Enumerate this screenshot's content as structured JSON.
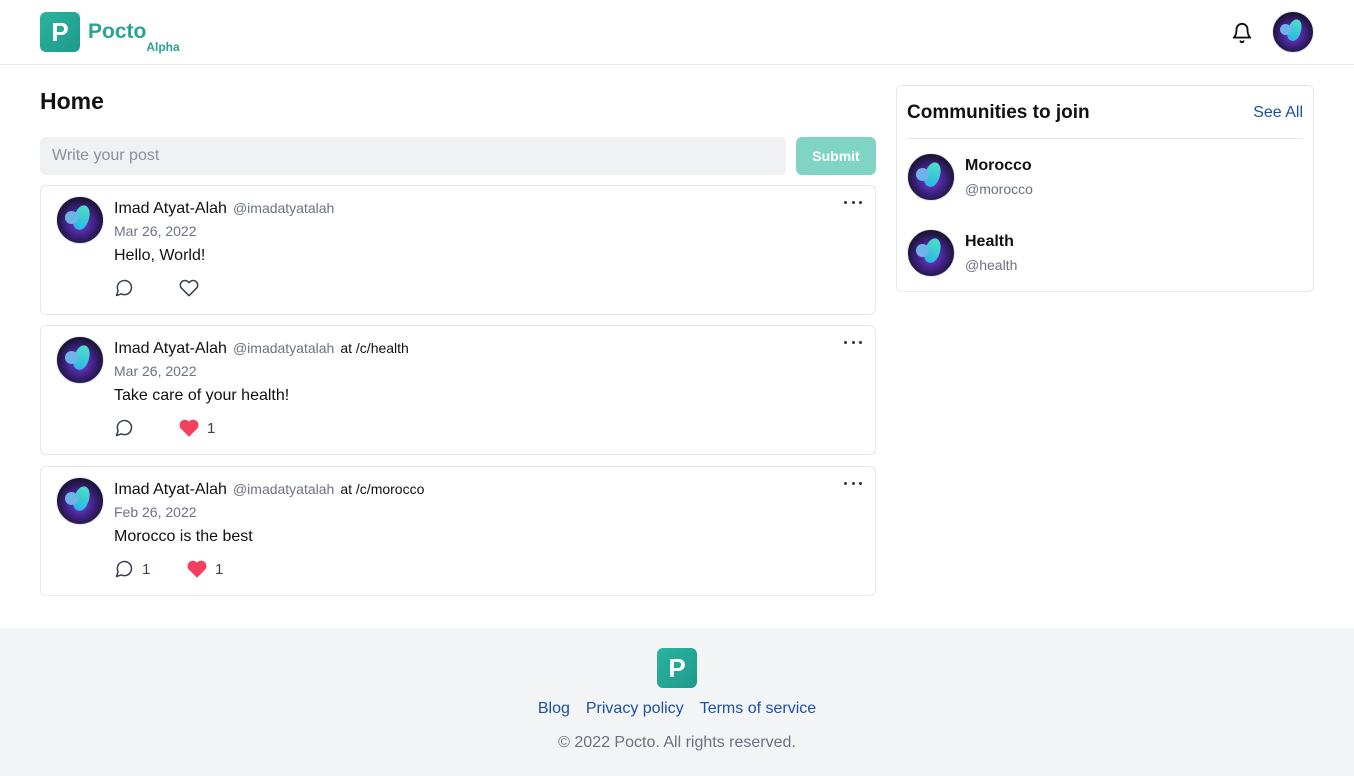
{
  "brand": {
    "name": "Pocto",
    "tag": "Alpha",
    "logo_letter": "P",
    "accent": "#2aa393"
  },
  "header": {
    "bell_icon": "bell-icon",
    "avatar_icon": "user-avatar"
  },
  "main": {
    "title": "Home",
    "composer": {
      "placeholder": "Write your post",
      "submit_label": "Submit"
    },
    "posts": [
      {
        "author": "Imad Atyat-Alah",
        "handle": "@imadatyatalah",
        "community": "",
        "date": "Mar 26, 2022",
        "body": "Hello, World!",
        "comments": "",
        "likes": "",
        "liked": false
      },
      {
        "author": "Imad Atyat-Alah",
        "handle": "@imadatyatalah",
        "community": "at /c/health",
        "date": "Mar 26, 2022",
        "body": "Take care of your health!",
        "comments": "",
        "likes": "1",
        "liked": true
      },
      {
        "author": "Imad Atyat-Alah",
        "handle": "@imadatyatalah",
        "community": "at /c/morocco",
        "date": "Feb 26, 2022",
        "body": "Morocco is the best",
        "comments": "1",
        "likes": "1",
        "liked": true
      }
    ]
  },
  "sidebar": {
    "title": "Communities to join",
    "see_all_label": "See All",
    "communities": [
      {
        "name": "Morocco",
        "handle": "@morocco"
      },
      {
        "name": "Health",
        "handle": "@health"
      }
    ]
  },
  "footer": {
    "links": [
      "Blog",
      "Privacy policy",
      "Terms of service"
    ],
    "copyright": "© 2022 Pocto. All rights reserved."
  },
  "colors": {
    "liked_heart": "#f43f5e",
    "link": "#1d4fa6",
    "submit_bg": "#7fd4c3"
  }
}
